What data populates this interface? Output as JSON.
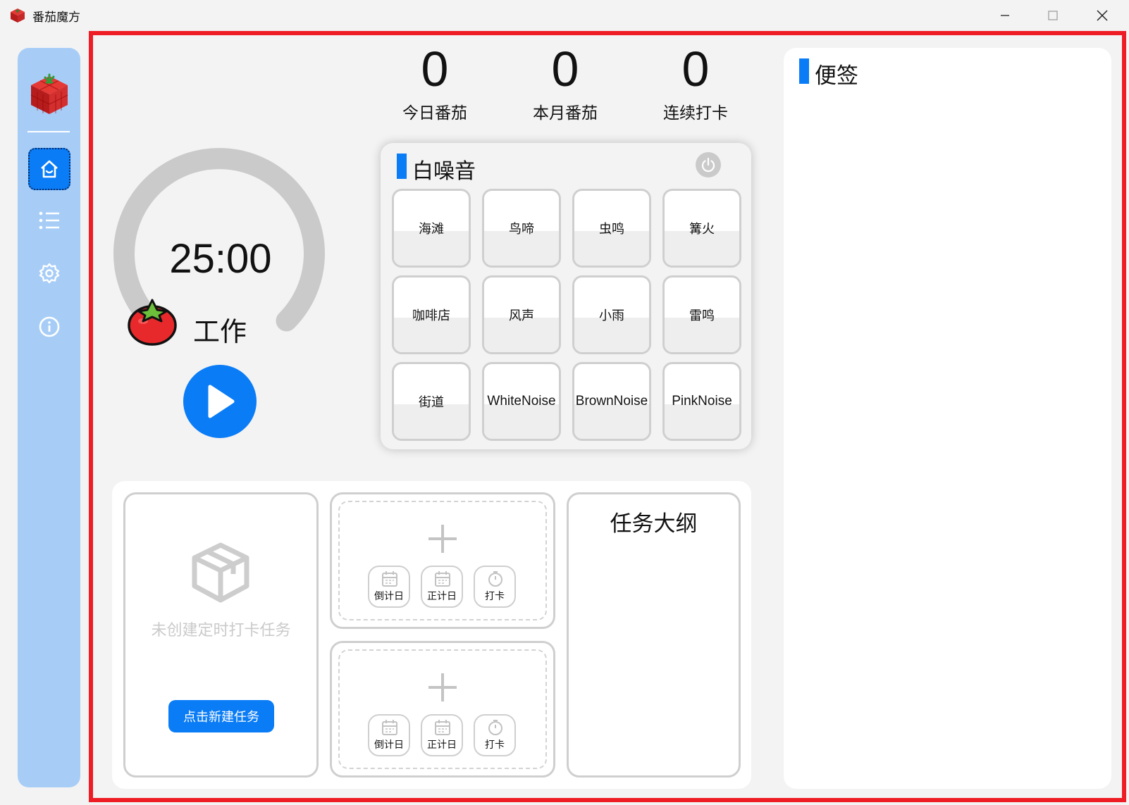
{
  "window": {
    "title": "番茄魔方"
  },
  "stats": [
    {
      "value": "0",
      "label": "今日番茄"
    },
    {
      "value": "0",
      "label": "本月番茄"
    },
    {
      "value": "0",
      "label": "连续打卡"
    }
  ],
  "timer": {
    "time": "25:00",
    "mode": "工作",
    "progress": 0.72
  },
  "white_noise": {
    "title": "白噪音",
    "sounds": [
      "海滩",
      "鸟啼",
      "虫鸣",
      "篝火",
      "咖啡店",
      "风声",
      "小雨",
      "雷鸣",
      "街道",
      "WhiteNoise",
      "BrownNoise",
      "PinkNoise"
    ]
  },
  "checkin": {
    "empty_text": "未创建定时打卡任务",
    "new_task_label": "点击新建任务"
  },
  "quick_actions": {
    "countdown": "倒计日",
    "countup": "正计日",
    "checkin": "打卡"
  },
  "outline": {
    "title": "任务大纲"
  },
  "notes": {
    "title": "便签"
  },
  "colors": {
    "accent": "#0a7cf6",
    "sidebar": "#a7cdf7",
    "highlight_frame": "#ee1c25",
    "ring": "#cacaca"
  }
}
